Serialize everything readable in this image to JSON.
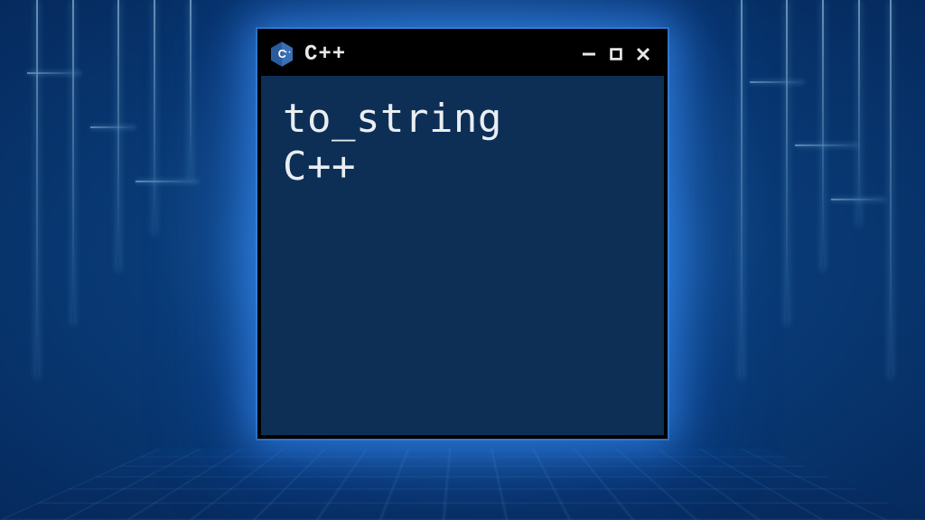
{
  "window": {
    "title": "C++",
    "icon_name": "cpp-icon"
  },
  "content": {
    "line1": "to_string",
    "line2": "C++"
  },
  "controls": {
    "minimize_label": "Minimize",
    "maximize_label": "Maximize",
    "close_label": "Close"
  }
}
